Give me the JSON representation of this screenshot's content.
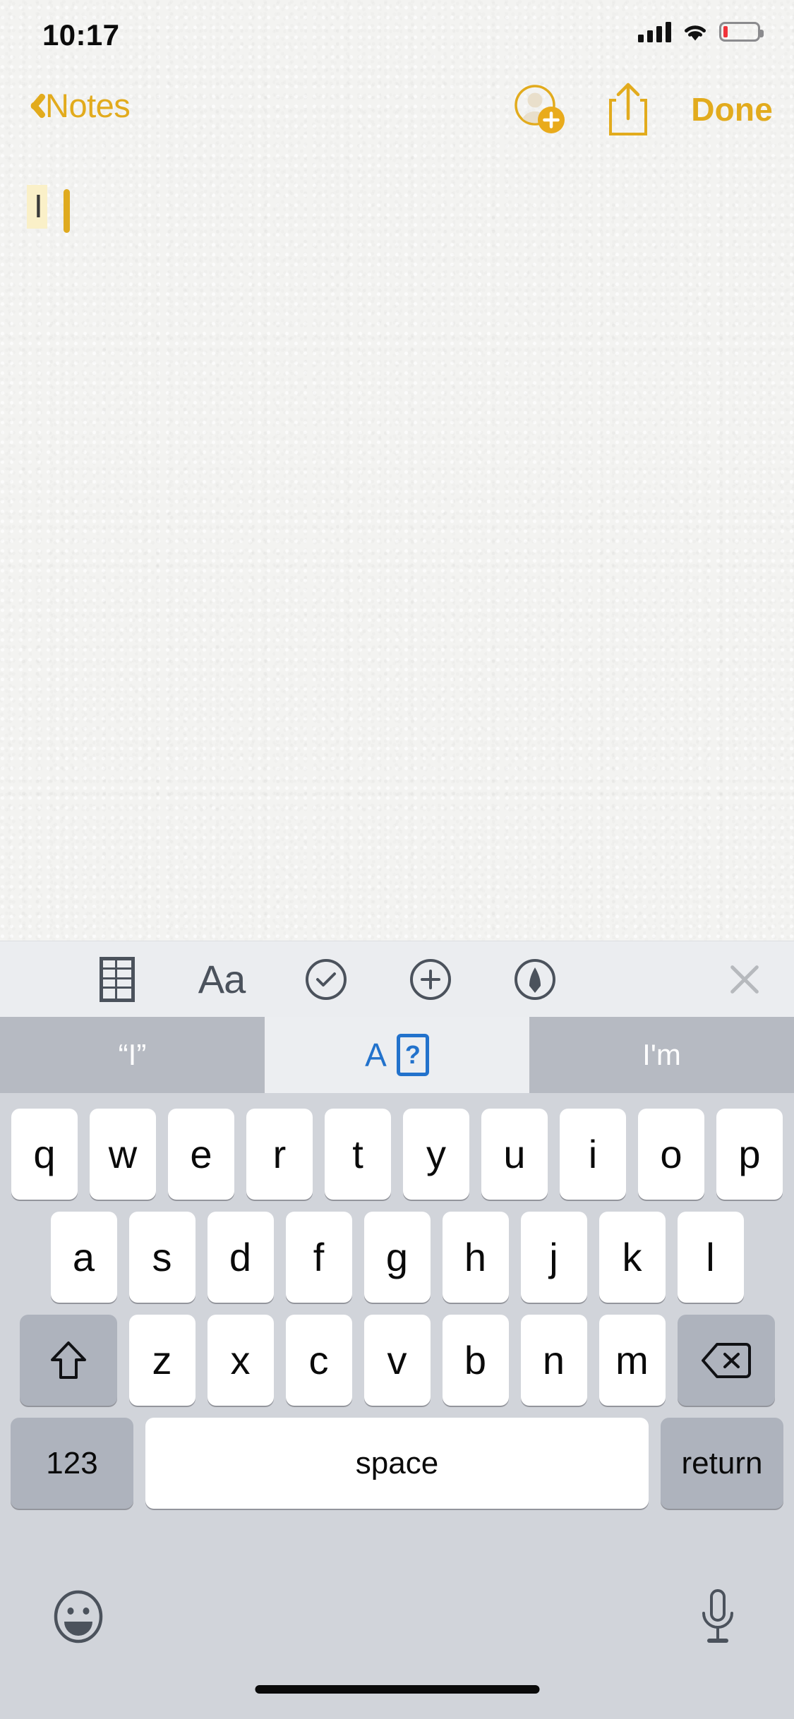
{
  "status_bar": {
    "time": "10:17",
    "signal_icon": "cellular-signal-icon",
    "signal_bars": 4,
    "wifi_icon": "wifi-icon",
    "battery_icon": "battery-low-icon",
    "battery_level_percent": 8,
    "battery_color": "#f0333a"
  },
  "nav_bar": {
    "back_icon": "chevron-left-icon",
    "back_label": "Notes",
    "add_person_icon": "add-person-icon",
    "share_icon": "share-icon",
    "done_label": "Done",
    "accent_color": "#e2ab1d"
  },
  "note": {
    "text": "I",
    "selection_highlight_color": "#faf0c8",
    "caret_color": "#dfaa1e"
  },
  "format_toolbar": {
    "background": "#ebedf0",
    "items": [
      {
        "name": "table-icon",
        "label": ""
      },
      {
        "name": "format-aa-icon",
        "label": "Aa"
      },
      {
        "name": "checklist-icon",
        "label": ""
      },
      {
        "name": "add-attachment-icon",
        "label": ""
      },
      {
        "name": "markup-pen-icon",
        "label": ""
      }
    ],
    "close_icon": "close-icon"
  },
  "predictive_bar": {
    "suggestions": [
      {
        "name": "suggestion-quoted",
        "text": "“I”",
        "selected": false
      },
      {
        "name": "suggestion-autocorrect",
        "text": "A",
        "badge": "?",
        "selected": true
      },
      {
        "name": "suggestion-next-word",
        "text": "I'm",
        "selected": false
      }
    ],
    "selected_color": "#2272cc",
    "chip_color": "#b6bac2"
  },
  "keyboard": {
    "background": "#d1d4da",
    "rows": [
      [
        "q",
        "w",
        "e",
        "r",
        "t",
        "y",
        "u",
        "i",
        "o",
        "p"
      ],
      [
        "a",
        "s",
        "d",
        "f",
        "g",
        "h",
        "j",
        "k",
        "l"
      ],
      [
        "z",
        "x",
        "c",
        "v",
        "b",
        "n",
        "m"
      ]
    ],
    "shift_icon": "shift-icon",
    "delete_icon": "backspace-delete-icon",
    "numbers_label": "123",
    "space_label": "space",
    "return_label": "return",
    "emoji_icon": "emoji-smiley-icon",
    "dictation_icon": "microphone-icon",
    "home_indicator": "home-indicator"
  }
}
